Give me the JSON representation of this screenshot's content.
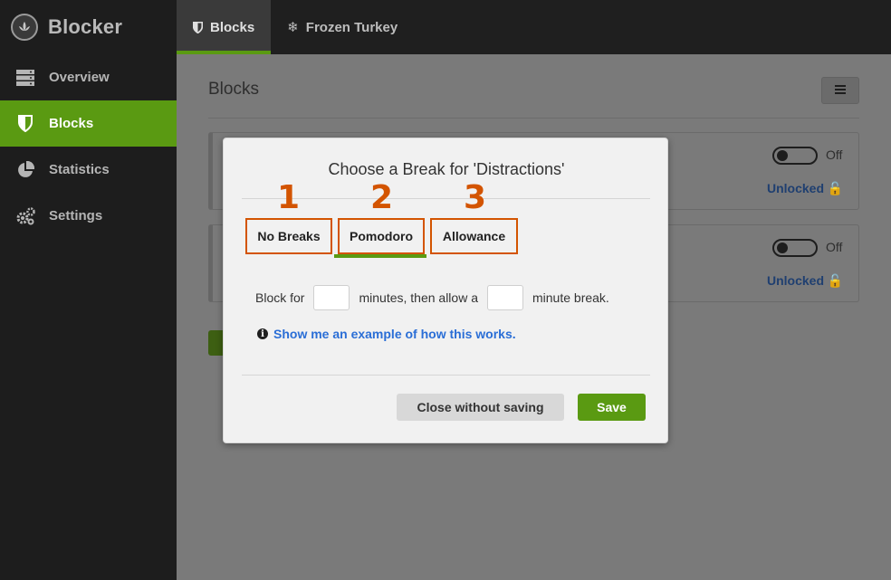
{
  "app": {
    "name": "Blocker"
  },
  "sidebar": {
    "items": [
      {
        "label": "Overview",
        "icon": "server-icon",
        "active": false
      },
      {
        "label": "Blocks",
        "icon": "shield-icon",
        "active": true
      },
      {
        "label": "Statistics",
        "icon": "pie-chart-icon",
        "active": false
      },
      {
        "label": "Settings",
        "icon": "gears-icon",
        "active": false
      }
    ]
  },
  "tabs": [
    {
      "label": "Blocks",
      "icon": "shield-icon",
      "active": true
    },
    {
      "label": "Frozen Turkey",
      "icon": "snowflake-icon",
      "active": false
    }
  ],
  "main": {
    "title": "Blocks",
    "cards": [
      {
        "status": "Off",
        "lock": "Unlocked"
      },
      {
        "status": "Off",
        "lock": "Unlocked"
      }
    ]
  },
  "modal": {
    "title": "Choose a Break for 'Distractions'",
    "annotations": [
      "1",
      "2",
      "3"
    ],
    "options": [
      {
        "label": "No Breaks"
      },
      {
        "label": "Pomodoro",
        "selected": true
      },
      {
        "label": "Allowance"
      }
    ],
    "row": {
      "prefix": "Block for",
      "middle": "minutes, then allow a",
      "suffix": "minute break.",
      "block_minutes": "",
      "break_minutes": ""
    },
    "example_link": "Show me an example of how this works.",
    "buttons": {
      "close": "Close without saving",
      "save": "Save"
    }
  },
  "colors": {
    "accent": "#5a9a12",
    "annotation": "#d35400",
    "link": "#2a6ed6"
  }
}
